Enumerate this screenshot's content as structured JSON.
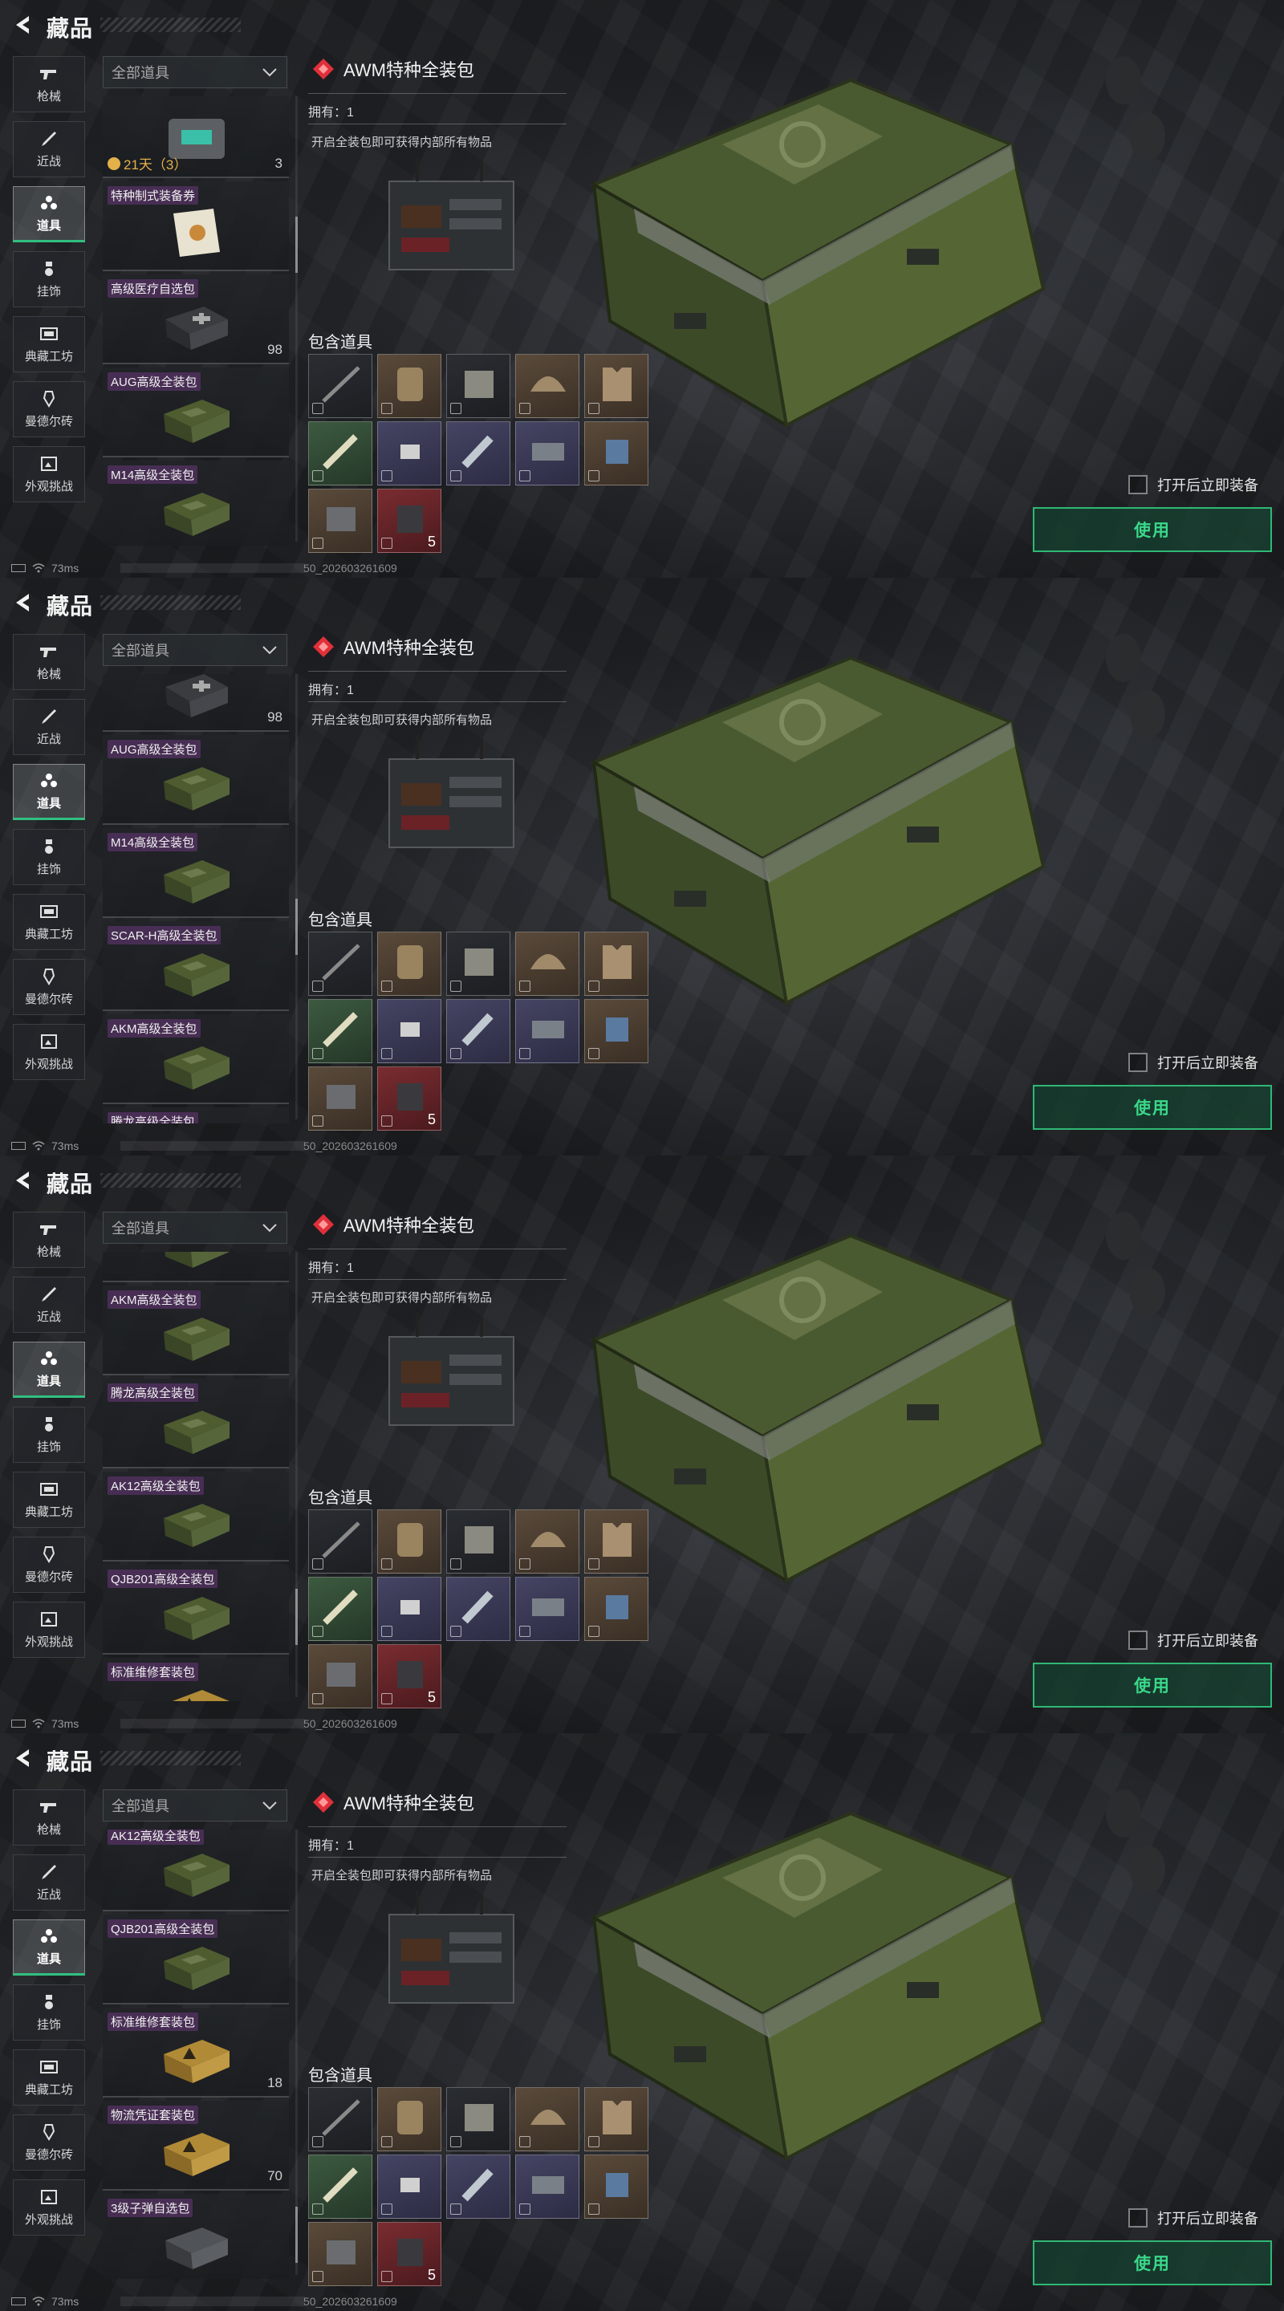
{
  "header": {
    "title": "藏品"
  },
  "sidebar": [
    {
      "label": "枪械",
      "icon": "gun-icon"
    },
    {
      "label": "近战",
      "icon": "knife-icon"
    },
    {
      "label": "道具",
      "icon": "items-icon",
      "active": true
    },
    {
      "label": "挂饰",
      "icon": "charm-icon"
    },
    {
      "label": "典藏工坊",
      "icon": "workshop-icon"
    },
    {
      "label": "曼德尔砖",
      "icon": "brick-icon"
    },
    {
      "label": "外观挑战",
      "icon": "challenge-icon"
    }
  ],
  "filter": {
    "label": "全部道具"
  },
  "detail": {
    "name": "AWM特种全装包",
    "owned": "拥有：1",
    "description": "开启全装包即可获得内部所有物品",
    "contains_label": "包含道具",
    "contents": [
      {
        "name": "rifle",
        "bg": "dark"
      },
      {
        "name": "backpack",
        "bg": "brown"
      },
      {
        "name": "chest-rig",
        "bg": "dark"
      },
      {
        "name": "helmet",
        "bg": "brown"
      },
      {
        "name": "armor-vest",
        "bg": "brown"
      },
      {
        "name": "syringe",
        "bg": "green"
      },
      {
        "name": "bandage",
        "bg": "purple"
      },
      {
        "name": "tourniquet",
        "bg": "purple"
      },
      {
        "name": "ammo-box",
        "bg": "purple"
      },
      {
        "name": "ammo-pack",
        "bg": "brown"
      },
      {
        "name": "med-kit",
        "bg": "brown"
      },
      {
        "name": "ammo-case",
        "bg": "red",
        "count": "5"
      }
    ]
  },
  "options": {
    "auto_equip_label": "打开后立即装备",
    "use_label": "使用"
  },
  "status": {
    "ping": "73ms",
    "uid": "50_202603261609"
  },
  "panels": [
    {
      "items": [
        {
          "label": "",
          "count": "3",
          "timer": "21天（3）",
          "thumb": "device"
        },
        {
          "label": "特种制式装备券",
          "count": "",
          "thumb": "ticket"
        },
        {
          "label": "高级医疗自选包",
          "count": "98",
          "thumb": "medbag"
        },
        {
          "label": "AUG高级全装包",
          "count": "",
          "thumb": "crate"
        },
        {
          "label": "M14高级全装包",
          "count": "",
          "thumb": "crate"
        }
      ]
    },
    {
      "items": [
        {
          "label": "",
          "count": "98",
          "thumb": "medbag"
        },
        {
          "label": "AUG高级全装包",
          "count": "",
          "thumb": "crate"
        },
        {
          "label": "M14高级全装包",
          "count": "",
          "thumb": "crate"
        },
        {
          "label": "SCAR-H高级全装包",
          "count": "",
          "thumb": "crate"
        },
        {
          "label": "AKM高级全装包",
          "count": "",
          "thumb": "crate"
        },
        {
          "label": "腾龙高级全装包",
          "count": "",
          "thumb": "crate"
        }
      ]
    },
    {
      "items": [
        {
          "label": "",
          "count": "",
          "thumb": "crate"
        },
        {
          "label": "AKM高级全装包",
          "count": "",
          "thumb": "crate"
        },
        {
          "label": "腾龙高级全装包",
          "count": "",
          "thumb": "crate"
        },
        {
          "label": "AK12高级全装包",
          "count": "",
          "thumb": "crate"
        },
        {
          "label": "QJB201高级全装包",
          "count": "",
          "thumb": "crate"
        },
        {
          "label": "标准维修套装包",
          "count": "",
          "thumb": "yellowbox"
        }
      ]
    },
    {
      "items": [
        {
          "label": "AK12高级全装包",
          "count": "",
          "thumb": "crate"
        },
        {
          "label": "QJB201高级全装包",
          "count": "",
          "thumb": "crate"
        },
        {
          "label": "标准维修套装包",
          "count": "18",
          "thumb": "yellowbox"
        },
        {
          "label": "物流凭证套装包",
          "count": "70",
          "thumb": "yellowbox"
        },
        {
          "label": "3级子弹自选包",
          "count": "",
          "thumb": "ammobox"
        }
      ]
    }
  ],
  "colors": {
    "accent": "#2fb874",
    "accent_text": "#3ad88a",
    "diamond": "#e0303a"
  }
}
